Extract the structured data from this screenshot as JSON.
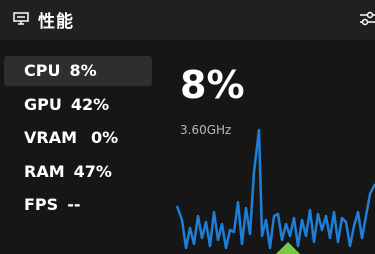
{
  "header": {
    "title": "性能",
    "app_icon": "monitor-icon",
    "settings_icon": "sliders-icon"
  },
  "metrics": [
    {
      "label": "CPU",
      "value": "8%"
    },
    {
      "label": "GPU",
      "value": "42%"
    },
    {
      "label": "VRAM",
      "value": "0%"
    },
    {
      "label": "RAM",
      "value": "47%"
    },
    {
      "label": "FPS",
      "value": "--"
    }
  ],
  "selected_metric": "CPU",
  "detail": {
    "big_value": "8%",
    "clock": "3.60GHz"
  },
  "colors": {
    "graph_line": "#1e7fd6",
    "graph_accent": "#7ac943",
    "background": "#161616"
  }
}
